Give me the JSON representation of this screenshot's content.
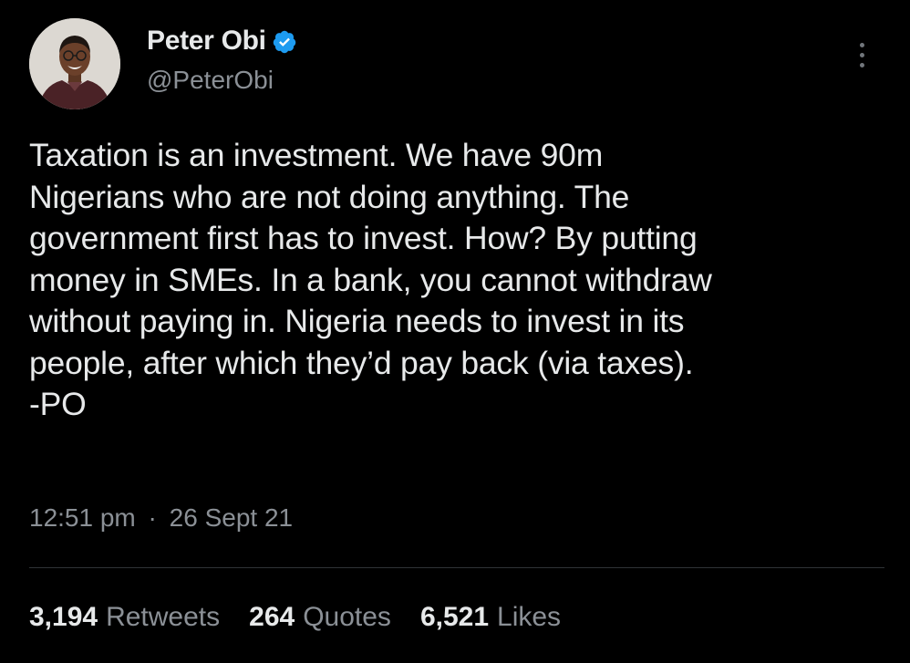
{
  "tweet": {
    "author": {
      "display_name": "Peter Obi",
      "handle": "@PeterObi",
      "verified": true,
      "verified_color": "#1d9bf0"
    },
    "text_lines": [
      "Taxation is an investment. We have 90m",
      "Nigerians who are not doing anything. The",
      "government first has to invest. How? By putting",
      "money in SMEs. In a bank, you cannot withdraw",
      "without paying in. Nigeria needs to invest in its",
      "people, after which they’d pay back (via taxes).",
      "-PO"
    ],
    "time": "12:51 pm",
    "separator": "·",
    "date": "26 Sept 21",
    "stats": {
      "retweets": {
        "count": "3,194",
        "label": "Retweets"
      },
      "quotes": {
        "count": "264",
        "label": "Quotes"
      },
      "likes": {
        "count": "6,521",
        "label": "Likes"
      }
    }
  },
  "icons": {
    "more": "more-options-icon",
    "verified": "verified-badge-icon"
  },
  "colors": {
    "background": "#000000",
    "primary_text": "#e7e9ea",
    "secondary_text": "#8b9096",
    "divider": "#2f3336"
  }
}
